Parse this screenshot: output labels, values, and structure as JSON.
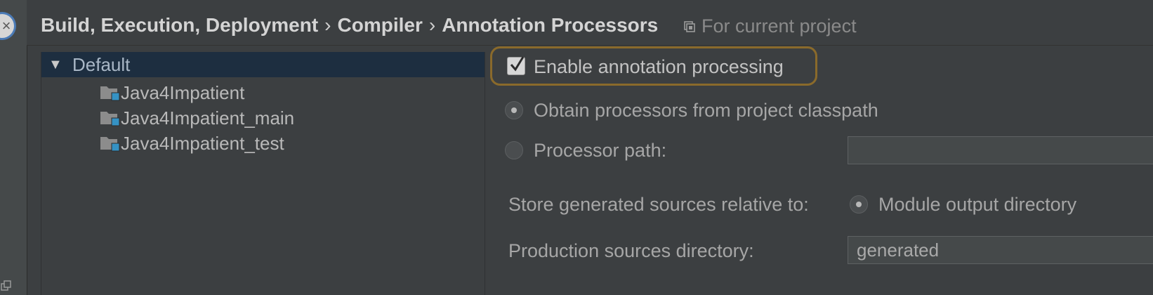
{
  "breadcrumb": {
    "items": [
      "Build, Execution, Deployment",
      "Compiler",
      "Annotation Processors"
    ],
    "separator": "›",
    "scope_label": "For current project"
  },
  "tree": {
    "root_label": "Default",
    "modules": [
      "Java4Impatient",
      "Java4Impatient_main",
      "Java4Impatient_test"
    ]
  },
  "settings": {
    "enable_label": "Enable annotation processing",
    "enable_checked": true,
    "obtain_classpath_label": "Obtain processors from project classpath",
    "processor_path_label": "Processor path:",
    "processor_path_value": "",
    "store_relative_label": "Store generated sources relative to:",
    "module_output_label": "Module output directory",
    "production_dir_label": "Production sources directory:",
    "production_dir_value": "generated"
  },
  "colors": {
    "background": "#3c3f41",
    "selection": "#1d2e40",
    "focus_ring": "#8a6a2b",
    "module_badge": "#3592c4"
  }
}
